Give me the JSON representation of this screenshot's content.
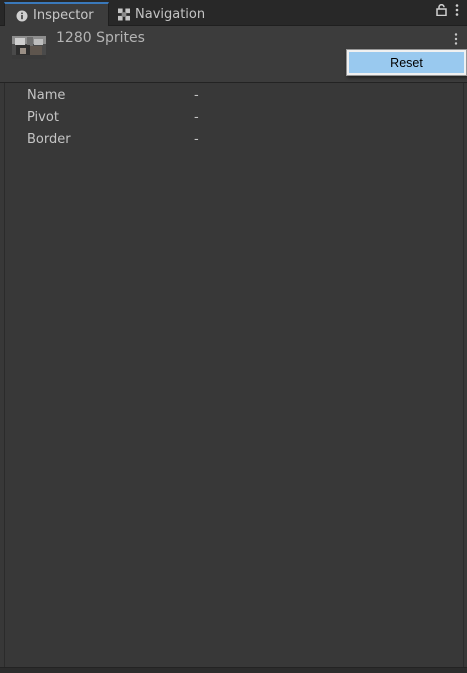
{
  "tabs": [
    {
      "label": "Inspector",
      "icon": "info-icon",
      "active": true
    },
    {
      "label": "Navigation",
      "icon": "navigation-icon",
      "active": false
    }
  ],
  "tabbar_icons": [
    "lock-icon",
    "kebab-menu-icon"
  ],
  "header": {
    "title": "1280 Sprites",
    "thumbnail_icon": "sprite-thumbnail"
  },
  "context_menu": {
    "items": [
      {
        "label": "Reset"
      }
    ]
  },
  "properties": [
    {
      "label": "Name",
      "value": "-"
    },
    {
      "label": "Pivot",
      "value": "-"
    },
    {
      "label": "Border",
      "value": "-"
    }
  ],
  "colors": {
    "accent": "#3a79bb",
    "menu_highlight": "#99c9ef",
    "panel_bg": "#383838"
  }
}
